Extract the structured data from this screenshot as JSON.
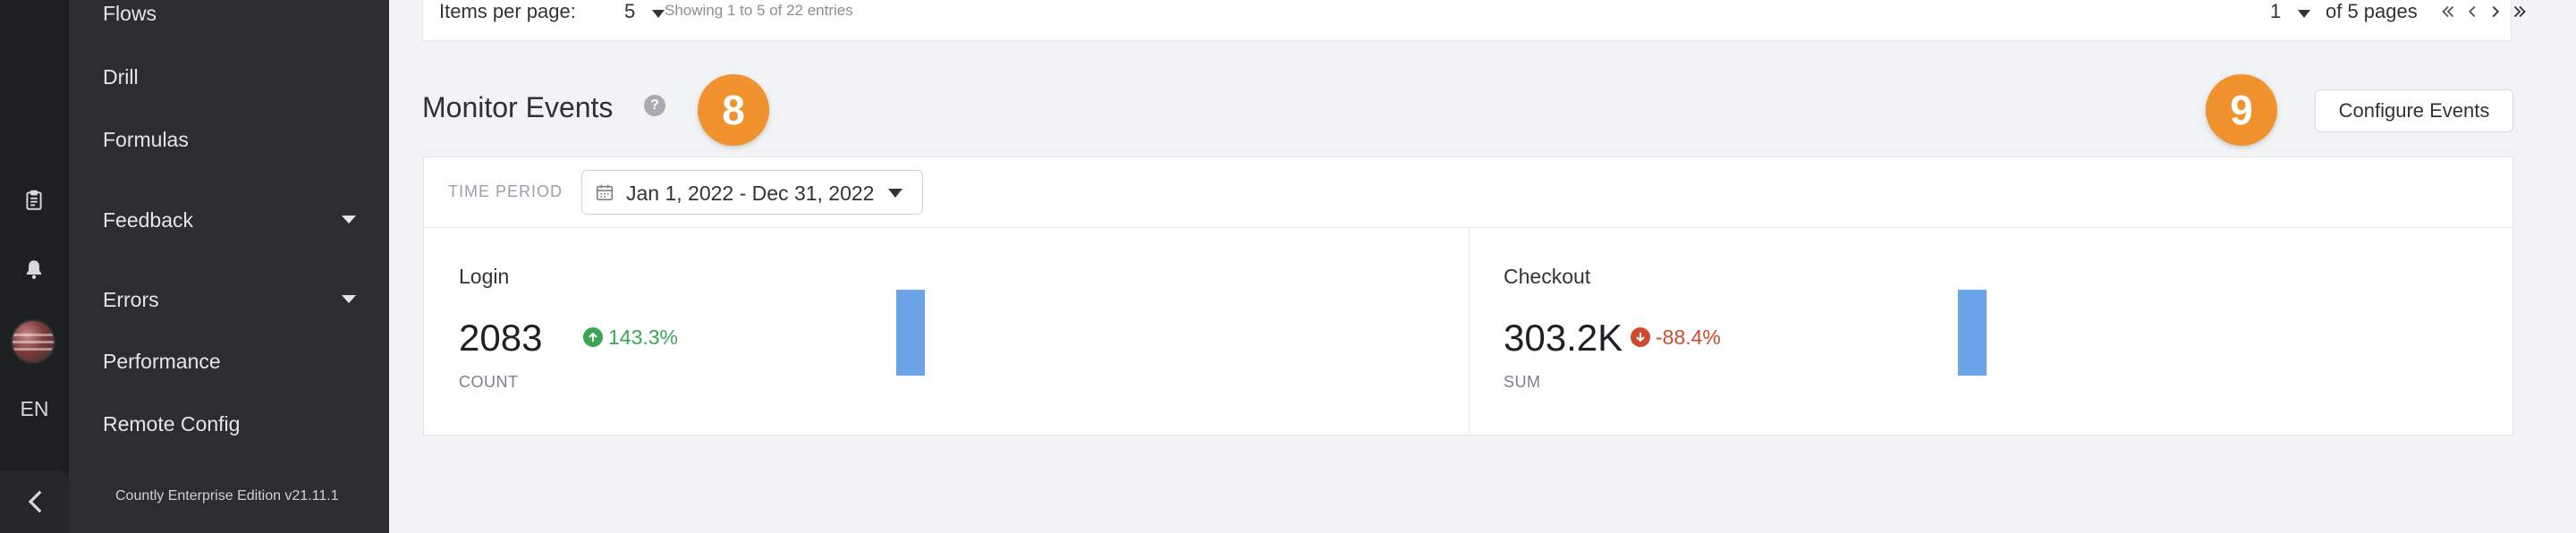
{
  "colors": {
    "accent_blue": "#6ba3e8",
    "badge_orange": "#f0932f",
    "positive_green": "#3aa655",
    "negative_red": "#cf4a2c",
    "sidebar_bg": "#2b2e31",
    "rail_bg": "#1d1f21"
  },
  "rail": {
    "icons": [
      "clipboard-icon",
      "bell-icon",
      "avatar",
      "collapse-chevron-icon"
    ],
    "language": "EN"
  },
  "sidebar": {
    "items": [
      {
        "label": "Flows",
        "has_caret": false
      },
      {
        "label": "Drill",
        "has_caret": false
      },
      {
        "label": "Formulas",
        "has_caret": false
      },
      {
        "label": "Feedback",
        "has_caret": true
      },
      {
        "label": "Errors",
        "has_caret": true
      },
      {
        "label": "Performance",
        "has_caret": false
      },
      {
        "label": "Remote Config",
        "has_caret": false
      }
    ],
    "edition": "Countly Enterprise Edition v21.11.1"
  },
  "pager": {
    "items_per_page_label": "Items per page:",
    "items_per_page_value": "5",
    "showing": "Showing 1 to 5 of 22 entries",
    "current_page": "1",
    "of_pages": "of 5 pages",
    "nav_icons": [
      "first-page-icon",
      "prev-page-icon",
      "next-page-icon",
      "last-page-icon"
    ]
  },
  "section": {
    "title": "Monitor Events",
    "help_glyph": "?",
    "badge_left": "8",
    "badge_right": "9",
    "configure_button": "Configure Events"
  },
  "filter": {
    "time_period_label": "TIME PERIOD",
    "date_range": "Jan 1, 2022 - Dec 31, 2022"
  },
  "metrics": [
    {
      "name": "Login",
      "value": "2083",
      "change": "143.3%",
      "direction": "up",
      "kind": "COUNT",
      "bar_fill": 1.0
    },
    {
      "name": "Checkout",
      "value": "303.2K",
      "change": "-88.4%",
      "direction": "down",
      "kind": "SUM",
      "bar_fill": 1.0
    }
  ]
}
